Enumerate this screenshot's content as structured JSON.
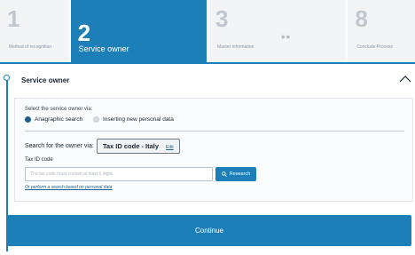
{
  "stepper": {
    "steps": [
      {
        "number": "1",
        "label": "Method of recognition"
      },
      {
        "number": "2",
        "label": "Service owner"
      },
      {
        "number": "3",
        "label": "Master information"
      },
      {
        "number": "8",
        "label": "Conclude Process"
      }
    ],
    "ellipsis": "••",
    "active_color": "#1d7fb8"
  },
  "section": {
    "title": "Service owner",
    "collapse_icon": "chevron-up-icon"
  },
  "form": {
    "select_label": "Select the service owner via:",
    "radios": [
      {
        "label": "Anagraphic search",
        "selected": true
      },
      {
        "label": "Inserting new personal data",
        "selected": false
      }
    ],
    "search_for_label": "Search for the owner via:",
    "search_mode": "Tax ID code - Italy",
    "edit_label": "Edit",
    "field_label": "Tax ID code",
    "tax_placeholder": "The tax code must contain at least 6 digits",
    "tax_value": "",
    "research_label": "Research",
    "research_icon": "search-icon",
    "alt_link": "Or perform a search based on personal data"
  },
  "footer": {
    "continue_label": "Continue"
  }
}
